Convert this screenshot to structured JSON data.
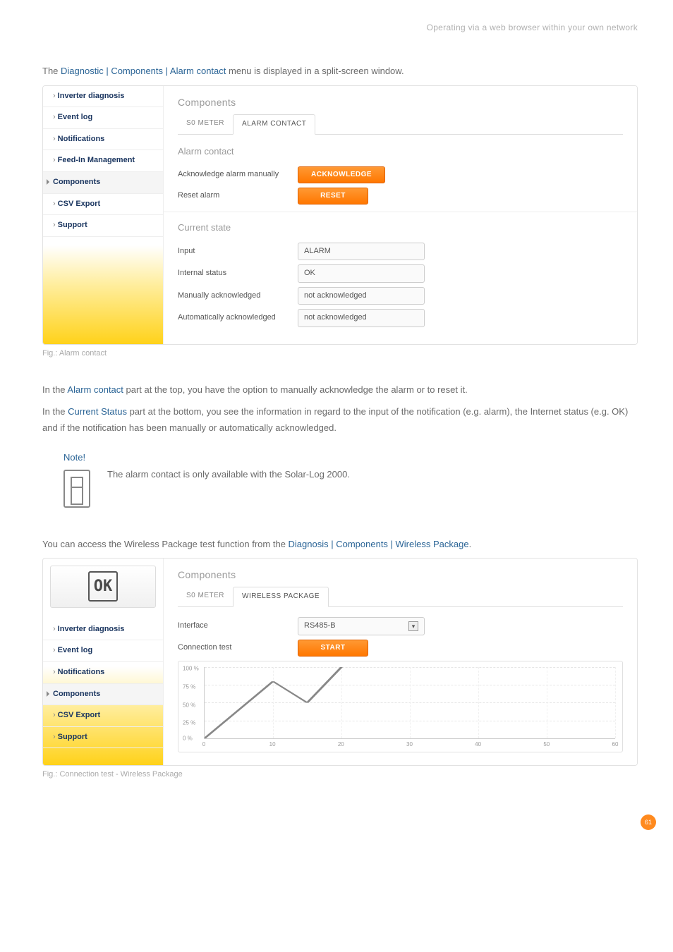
{
  "header": {
    "title": "Operating via a web browser within your own network"
  },
  "intro1_pre": "The ",
  "intro1_blue": "Diagnostic | Components | Alarm contact",
  "intro1_post": " menu is displayed in a split-screen window.",
  "panel1": {
    "sidebar": {
      "items": [
        {
          "label": "Inverter diagnosis"
        },
        {
          "label": "Event log"
        },
        {
          "label": "Notifications"
        },
        {
          "label": "Feed-In Management"
        },
        {
          "label": "Components",
          "active": true
        },
        {
          "label": "CSV Export"
        },
        {
          "label": "Support"
        }
      ]
    },
    "title": "Components",
    "tabs": [
      {
        "label": "S0 METER"
      },
      {
        "label": "ALARM CONTACT",
        "active": true
      }
    ],
    "alarm_head": "Alarm contact",
    "rows_top": [
      {
        "label": "Acknowledge alarm manually",
        "btn": "ACKNOWLEDGE"
      },
      {
        "label": "Reset alarm",
        "btn": "RESET"
      }
    ],
    "state_head": "Current state",
    "rows_state": [
      {
        "label": "Input",
        "value": "ALARM"
      },
      {
        "label": "Internal status",
        "value": "OK"
      },
      {
        "label": "Manually acknowledged",
        "value": "not acknowledged"
      },
      {
        "label": "Automatically acknowledged",
        "value": "not acknowledged"
      }
    ]
  },
  "caption1": "Fig.: Alarm contact",
  "para1_pre": "In the ",
  "para1_blue": "Alarm contact",
  "para1_post": " part at the top, you have the option to manually acknowledge the alarm or to reset it.",
  "para2_pre": "In the ",
  "para2_blue": "Current Status",
  "para2_post": " part at the bottom, you see the information in regard to the input of the notification (e.g. alarm), the Internet status (e.g. OK) and if the notification has been manually or automatically acknowledged.",
  "note": {
    "title": "Note!",
    "text": "The alarm contact is only available with the Solar-Log 2000."
  },
  "para3_pre": "You can access the Wireless Package test function from the ",
  "para3_blue": "Diagnosis | Components | Wireless Package",
  "para3_post": ".",
  "panel2": {
    "sidebar": {
      "items": [
        {
          "label": "Inverter diagnosis"
        },
        {
          "label": "Event log"
        },
        {
          "label": "Notifications"
        },
        {
          "label": "Components",
          "active": true
        },
        {
          "label": "CSV Export"
        },
        {
          "label": "Support"
        }
      ]
    },
    "title": "Components",
    "tabs": [
      {
        "label": "S0 METER"
      },
      {
        "label": "WIRELESS PACKAGE",
        "active": true
      }
    ],
    "rows": [
      {
        "label": "Interface",
        "value": "RS485-B",
        "select": true
      },
      {
        "label": "Connection test",
        "btn": "START"
      }
    ]
  },
  "chart_data": {
    "type": "line",
    "x": [
      0,
      10,
      15,
      20
    ],
    "values": [
      0,
      80,
      50,
      100
    ],
    "xlabel": "",
    "ylabel": "",
    "xticks": [
      0,
      10,
      20,
      30,
      40,
      50,
      60
    ],
    "yticks": [
      "0 %",
      "25 %",
      "50 %",
      "75 %",
      "100 %"
    ],
    "xlim": [
      0,
      60
    ],
    "ylim": [
      0,
      100
    ]
  },
  "caption2": "Fig.: Connection test - Wireless Package",
  "pagenum": "61"
}
